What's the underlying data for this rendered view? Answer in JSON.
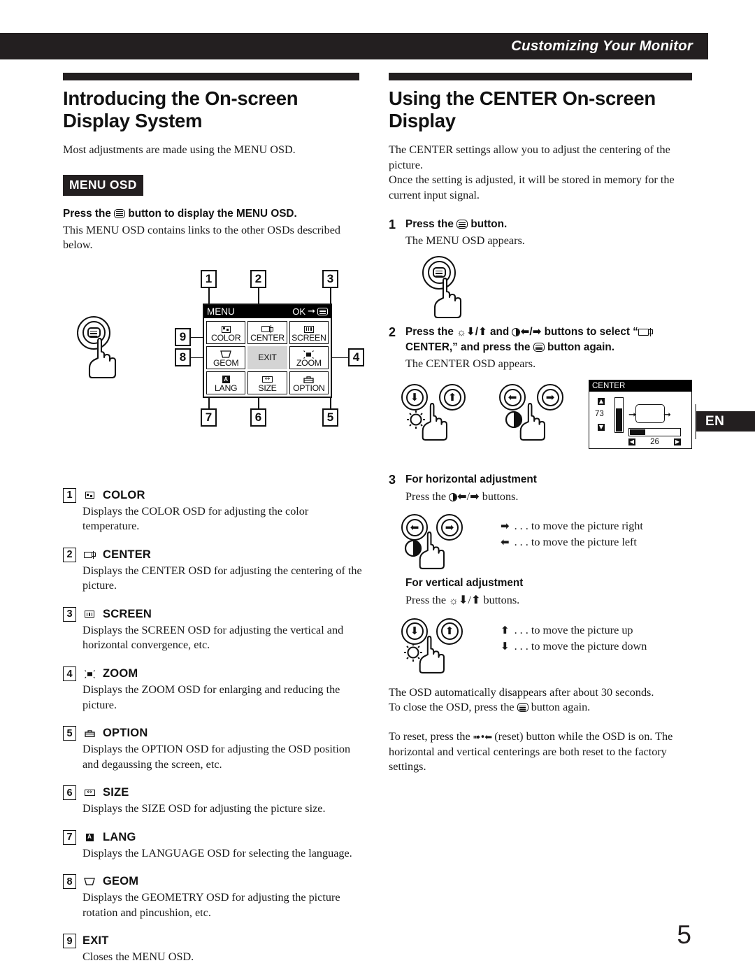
{
  "header": {
    "title": "Customizing Your Monitor"
  },
  "page": {
    "number": "5",
    "language_tab": "EN"
  },
  "left": {
    "heading": "Introducing the On-screen Display System",
    "intro": "Most adjustments are made using the MENU OSD.",
    "tag": "MENU OSD",
    "lead_pre": "Press the",
    "lead_post": "button to display the MENU OSD.",
    "lead_desc": "This MENU OSD contains links to the other OSDs described below.",
    "osd": {
      "title": "MENU",
      "ok_label": "OK",
      "cells": [
        {
          "label": "COLOR",
          "icon": "color-icon"
        },
        {
          "label": "CENTER",
          "icon": "center-icon"
        },
        {
          "label": "SCREEN",
          "icon": "screen-icon"
        },
        {
          "label": "GEOM",
          "icon": "geom-icon"
        },
        {
          "label": "EXIT",
          "icon": "none"
        },
        {
          "label": "ZOOM",
          "icon": "zoom-icon"
        },
        {
          "label": "LANG",
          "icon": "lang-icon"
        },
        {
          "label": "SIZE",
          "icon": "size-icon"
        },
        {
          "label": "OPTION",
          "icon": "option-icon"
        }
      ],
      "callouts": [
        "1",
        "2",
        "3",
        "4",
        "5",
        "6",
        "7",
        "8",
        "9"
      ]
    },
    "items": [
      {
        "num": "1",
        "icon": "color-icon",
        "title": "COLOR",
        "desc": "Displays the COLOR OSD for adjusting the color temperature."
      },
      {
        "num": "2",
        "icon": "center-icon",
        "title": "CENTER",
        "desc": "Displays the CENTER OSD for adjusting the centering of the picture."
      },
      {
        "num": "3",
        "icon": "screen-icon",
        "title": "SCREEN",
        "desc": "Displays the SCREEN OSD for adjusting the vertical and horizontal convergence, etc."
      },
      {
        "num": "4",
        "icon": "zoom-icon",
        "title": "ZOOM",
        "desc": "Displays the ZOOM OSD for enlarging and reducing the picture."
      },
      {
        "num": "5",
        "icon": "option-icon",
        "title": "OPTION",
        "desc": "Displays the OPTION OSD for adjusting the OSD position and degaussing the screen, etc."
      },
      {
        "num": "6",
        "icon": "size-icon",
        "title": "SIZE",
        "desc": "Displays the SIZE OSD for adjusting the picture size."
      },
      {
        "num": "7",
        "icon": "lang-icon",
        "title": "LANG",
        "desc": "Displays the LANGUAGE OSD for selecting the language."
      },
      {
        "num": "8",
        "icon": "geom-icon",
        "title": "GEOM",
        "desc": "Displays the GEOMETRY OSD for adjusting the picture rotation and pincushion, etc."
      },
      {
        "num": "9",
        "icon": "none",
        "title": "EXIT",
        "desc": "Closes the MENU OSD."
      }
    ]
  },
  "right": {
    "heading": "Using the CENTER On-screen Display",
    "intro1": "The CENTER settings allow you to adjust the centering of the picture.",
    "intro2": "Once the setting is adjusted, it will be stored in memory for the current input signal.",
    "step1": {
      "num": "1",
      "title_pre": "Press the",
      "title_post": "button.",
      "desc": "The MENU OSD appears."
    },
    "step2": {
      "num": "2",
      "line1_a": "Press the",
      "line1_b": "and",
      "line1_c": "buttons to select “",
      "line2_a": "CENTER,” and press the",
      "line2_b": "button again.",
      "desc": "The CENTER OSD appears."
    },
    "step3": {
      "num": "3",
      "h_title": "For horizontal adjustment",
      "h_press_pre": "Press the",
      "h_press_post": "buttons.",
      "h_legend": [
        {
          "sym": "➡",
          "text": ". . . to move the picture right"
        },
        {
          "sym": "⬅",
          "text": ". . . to move the picture left"
        }
      ],
      "v_title": "For vertical adjustment",
      "v_press_pre": "Press the",
      "v_press_post": "buttons.",
      "v_legend": [
        {
          "sym": "⬆",
          "text": ". . . to move the picture up"
        },
        {
          "sym": "⬇",
          "text": ". . . to move the picture down"
        }
      ]
    },
    "center_osd": {
      "title": "CENTER",
      "vertical_value": "73",
      "horizontal_value": "26",
      "up_arrow": "▲",
      "down_arrow": "▼",
      "left_arrow": "◀",
      "right_arrow": "▶"
    },
    "outro1": "The OSD automatically disappears after about 30 seconds.",
    "outro2_a": "To close the OSD, press the",
    "outro2_b": "button again.",
    "outro3_a": "To reset,  press the",
    "outro3_b": "(reset) button while the OSD is on. The horizontal and vertical centerings are both reset to the factory settings."
  }
}
